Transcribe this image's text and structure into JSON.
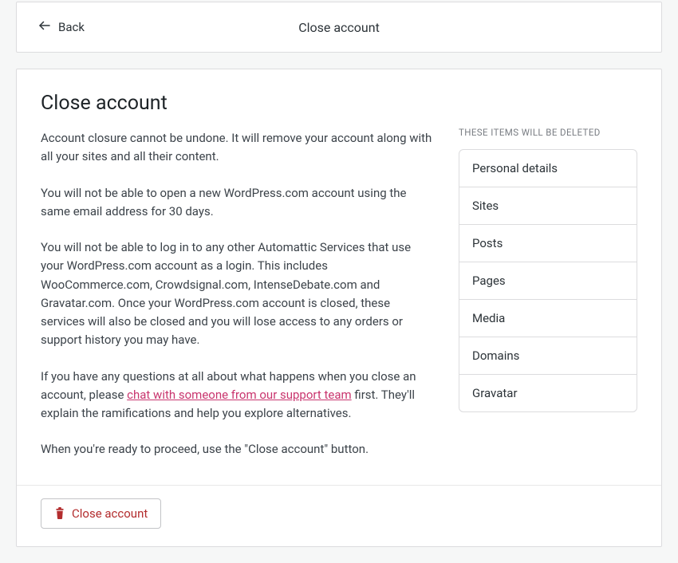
{
  "header": {
    "back_label": "Back",
    "title": "Close account"
  },
  "page": {
    "title": "Close account",
    "p1": "Account closure cannot be undone. It will remove your account along with all your sites and all their content.",
    "p2": "You will not be able to open a new WordPress.com account using the same email address for 30 days.",
    "p3": "You will not be able to log in to any other Automattic Services that use your WordPress.com account as a login. This includes WooCommerce.com, Crowdsignal.com, IntenseDebate.com and Gravatar.com. Once your WordPress.com account is closed, these services will also be closed and you will lose access to any orders or support history you may have.",
    "p4_pre": "If you have any questions at all about what happens when you close an account, please ",
    "p4_link": "chat with someone from our support team",
    "p4_post": " first. They'll explain the ramifications and help you explore alternatives.",
    "p5": "When you're ready to proceed, use the \"Close account\" button."
  },
  "deleted": {
    "heading": "THESE ITEMS WILL BE DELETED",
    "items": [
      "Personal details",
      "Sites",
      "Posts",
      "Pages",
      "Media",
      "Domains",
      "Gravatar"
    ]
  },
  "footer": {
    "close_button_label": "Close account"
  },
  "colors": {
    "danger": "#b32d2e",
    "link": "#c9356e"
  }
}
